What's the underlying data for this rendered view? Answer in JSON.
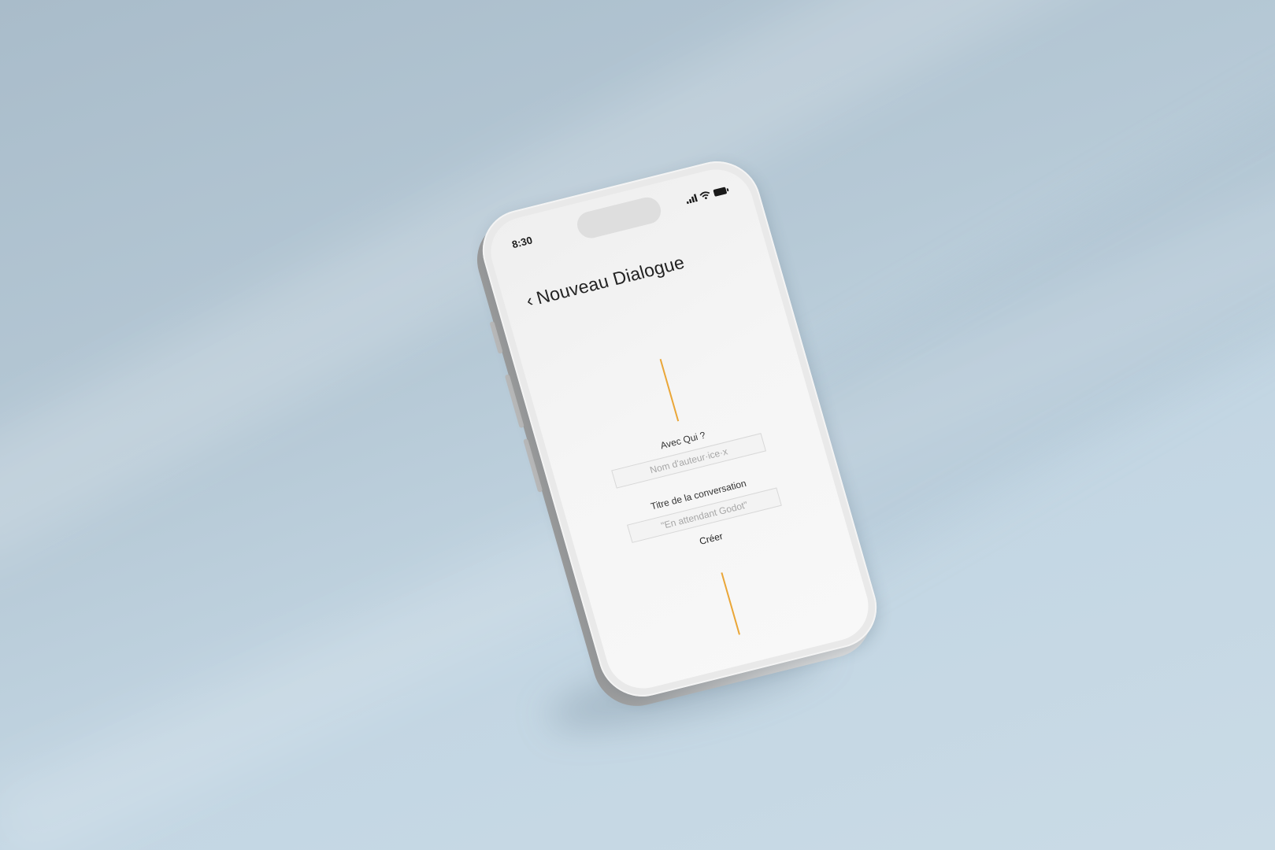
{
  "status_bar": {
    "time": "8:30",
    "icons": [
      "signal-icon",
      "wifi-icon",
      "battery-icon"
    ]
  },
  "header": {
    "back_icon": "chevron-left-icon",
    "title": "Nouveau Dialogue"
  },
  "form": {
    "with_label": "Avec Qui ?",
    "author_placeholder": "Nom d'auteur·ice·x",
    "author_value": "",
    "title_label": "Titre de la conversation",
    "title_placeholder": "\"En attendant Godot\"",
    "title_value": "",
    "create_label": "Créer"
  },
  "colors": {
    "accent": "#eaa637",
    "background": "#c3d6e3",
    "screen": "#f5f5f5"
  }
}
